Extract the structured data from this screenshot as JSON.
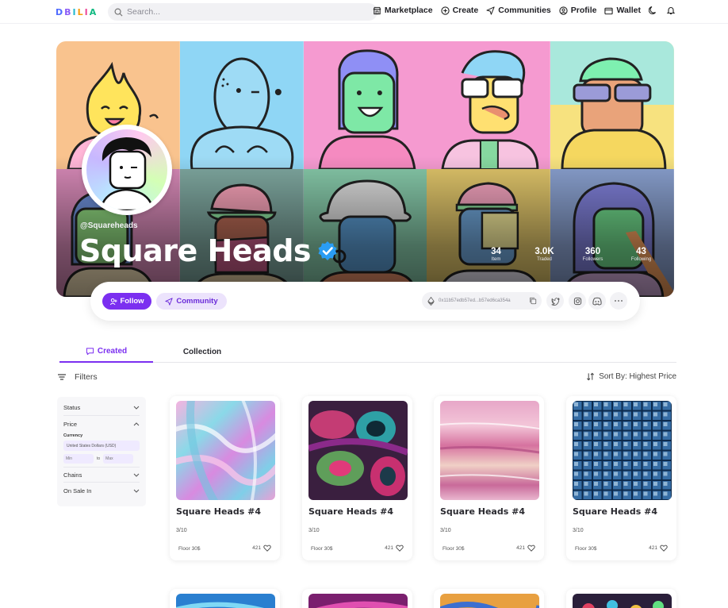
{
  "nav": {
    "logo": [
      "D",
      "B",
      "I",
      "L",
      "I",
      "A"
    ],
    "logo_colors": [
      "#4f6bff",
      "#8b5cf6",
      "#22b8cf",
      "#f59e0b",
      "#ec4899",
      "#10b981"
    ],
    "search_placeholder": "Search...",
    "links": {
      "marketplace": "Marketplace",
      "create": "Create",
      "communities": "Communities",
      "profile": "Profile",
      "wallet": "Wallet"
    }
  },
  "profile": {
    "handle": "@Squareheads",
    "name": "Square Heads",
    "verified_color": "#2a9df4",
    "stats": [
      {
        "value": "34",
        "label": "Item"
      },
      {
        "value": "3.0K",
        "label": "Traded"
      },
      {
        "value": "360",
        "label": "Followers"
      },
      {
        "value": "43",
        "label": "Following"
      }
    ],
    "follow_label": "Follow",
    "community_label": "Community",
    "address": "0x11b57edb57ed...b57ed6ca354a",
    "accent": "#7b2ff0"
  },
  "tabs": {
    "created": "Created",
    "collection": "Collection"
  },
  "filters": {
    "label": "Filters",
    "sort": "Sort By: Highest Price",
    "sections": {
      "status": "Status",
      "price": "Price",
      "currency_label": "Currency",
      "currency_value": "United States Dollars (USD)",
      "min": "Min",
      "to": "to",
      "max": "Max",
      "chains": "Chains",
      "on_sale_in": "On Sale In"
    }
  },
  "items": [
    {
      "title": "Square Heads #4",
      "edition": "3/10",
      "floor": "Floor 30$",
      "likes": "421"
    },
    {
      "title": "Square Heads #4",
      "edition": "3/10",
      "floor": "Floor 30$",
      "likes": "421"
    },
    {
      "title": "Square Heads #4",
      "edition": "3/10",
      "floor": "Floor 30$",
      "likes": "421"
    }
  ],
  "items_extra": {
    "title": "Square Heads #4",
    "edition": "3/10",
    "floor": "Floor 30$",
    "likes": "421"
  }
}
